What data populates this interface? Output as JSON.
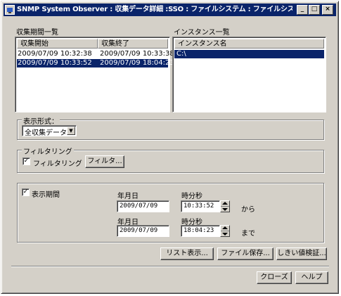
{
  "window": {
    "title": "SNMP System Observer : 収集データ詳細 :SSO : ファイルシステム : ファイルシステム使用率 :...",
    "minimize": "_",
    "maximize": "□",
    "close": "×"
  },
  "periods": {
    "label": "収集期間一覧",
    "columns": [
      "収集開始",
      "収集終了"
    ],
    "rows": [
      {
        "start": "2009/07/09 10:32:38",
        "end": "2009/07/09 10:33:38",
        "selected": false
      },
      {
        "start": "2009/07/09 10:33:52",
        "end": "2009/07/09 18:04:23",
        "selected": true
      }
    ]
  },
  "instances": {
    "label": "インスタンス一覧",
    "column": "インスタンス名",
    "rows": [
      {
        "name": "C:\\",
        "selected": true
      }
    ]
  },
  "display_format": {
    "label": "表示形式：",
    "selected": "全収集データ"
  },
  "filtering": {
    "label": "フィルタリング",
    "checkbox_label": "フィルタリング",
    "checked": true,
    "filter_button": "フィルタ..."
  },
  "display_period": {
    "checkbox_label": "表示期間",
    "checked": true,
    "date_label_1": "年月日",
    "time_label_1": "時分秒",
    "from_date": "2009/07/09",
    "from_time": "10:33:52",
    "from_suffix": "から",
    "date_label_2": "年月日",
    "time_label_2": "時分秒",
    "to_date": "2009/07/09",
    "to_time": "18:04:23",
    "to_suffix": "まで"
  },
  "actions": {
    "list_view": "リスト表示...",
    "save_file": "ファイル保存...",
    "threshold_check": "しきい値検証..."
  },
  "footer": {
    "close": "クローズ",
    "help": "ヘルプ"
  },
  "check_mark": "✓"
}
